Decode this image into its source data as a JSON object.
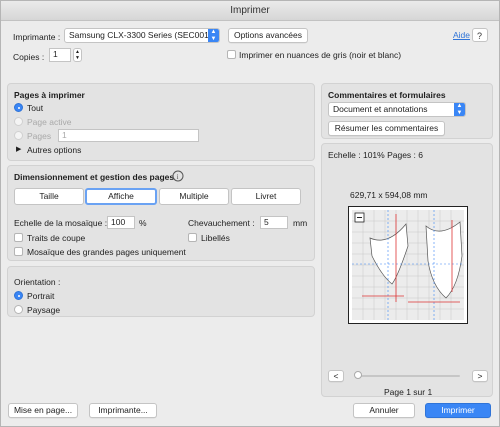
{
  "window": {
    "title": "Imprimer"
  },
  "top": {
    "printer_label": "Imprimante :",
    "printer_value": "Samsung CLX-3300 Series (SEC001...",
    "advanced_button": "Options avancées",
    "help_link": "Aide",
    "copies_label": "Copies :",
    "copies_value": "1",
    "grayscale_label": "Imprimer en nuances de gris (noir et blanc)"
  },
  "pages": {
    "heading": "Pages à imprimer",
    "all": "Tout",
    "current": "Page active",
    "range_label": "Pages",
    "range_value": "1",
    "more": "Autres options"
  },
  "sizing": {
    "heading": "Dimensionnement et gestion des pages",
    "segments": [
      "Taille",
      "Affiche",
      "Multiple",
      "Livret"
    ],
    "selected": "Affiche",
    "tile_scale_label": "Echelle de la mosaïque :",
    "tile_scale_value": "100",
    "tile_scale_unit": "%",
    "overlap_label": "Chevauchement :",
    "overlap_value": "5",
    "overlap_unit": "mm",
    "cut_marks": "Traits de coupe",
    "labels": "Libellés",
    "large_pages": "Mosaïque des grandes pages uniquement"
  },
  "orientation": {
    "heading": "Orientation :",
    "portrait": "Portrait",
    "landscape": "Paysage"
  },
  "comments": {
    "heading": "Commentaires et formulaires",
    "select_value": "Document et annotations",
    "summarize_button": "Résumer les commentaires"
  },
  "preview": {
    "scale_text": "Echelle : 101% Pages : 6",
    "dimensions": "629,71 x 594,08 mm",
    "page_indicator": "Page 1 sur 1",
    "slider_position": 0.0,
    "prev": "<",
    "next": ">"
  },
  "footer": {
    "page_setup": "Mise en page...",
    "printer": "Imprimante...",
    "cancel": "Annuler",
    "print": "Imprimer"
  },
  "colors": {
    "accent": "#3a86f5",
    "link": "#2f74d8"
  }
}
